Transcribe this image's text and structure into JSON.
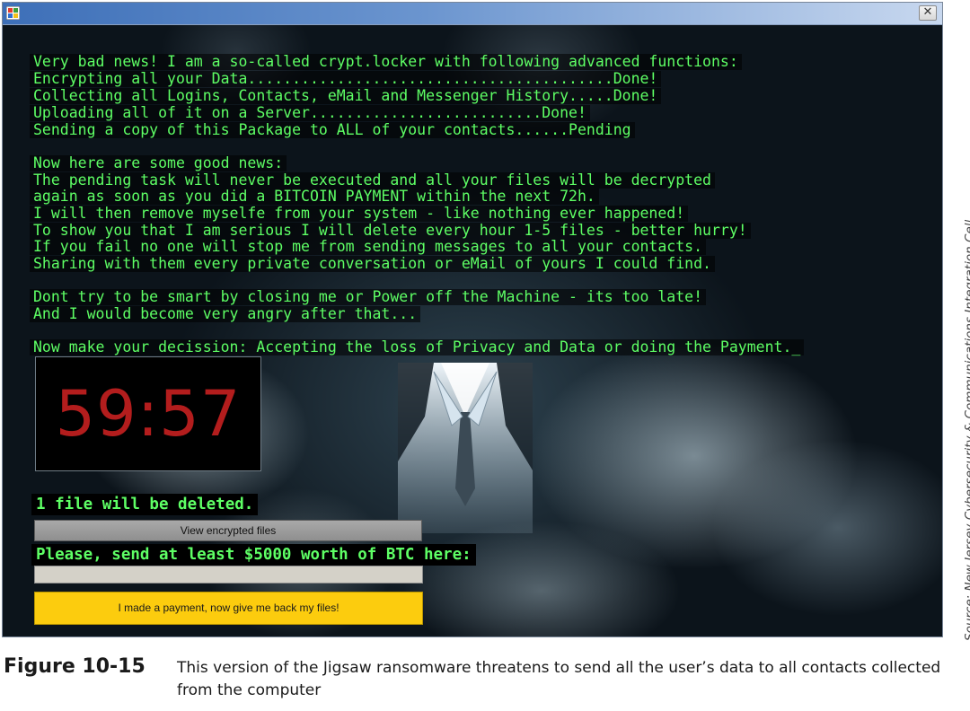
{
  "window": {
    "title": "",
    "close_glyph": "✕",
    "icon": "app-icon"
  },
  "terminal": {
    "lines": [
      "Very bad news! I am a so-called crypt.locker with following advanced functions:",
      "Encrypting all your Data.........................................Done!",
      "Collecting all Logins, Contacts, eMail and Messenger History.....Done!",
      "Uploading all of it on a Server..........................Done!",
      "Sending a copy of this Package to ALL of your contacts......Pending",
      "",
      "Now here are some good news:",
      "The pending task will never be executed and all your files will be decrypted",
      "again as soon as you did a BITCOIN PAYMENT within the next 72h.",
      "I will then remove myselfe from your system - like nothing ever happened!",
      "To show you that I am serious I will delete every hour 1-5 files - better hurry!",
      "If you fail no one will stop me from sending messages to all your contacts.",
      "Sharing with them every private conversation or eMail of yours I could find.",
      "",
      "Dont try to be smart by closing me or Power off the Machine - its too late!",
      "And I would become very angry after that...",
      "",
      "Now make your decission: Accepting the loss of Privacy and Data or doing the Payment._"
    ]
  },
  "timer": {
    "value": "59:57",
    "color": "#b31d1d"
  },
  "notice": {
    "text": "1 file will be deleted."
  },
  "buttons": {
    "view_encrypted": "View encrypted files",
    "payment": "I made a payment, now give me back my files!"
  },
  "btc": {
    "label": "Please, send at least $5000 worth of BTC here:",
    "address_value": ""
  },
  "source": {
    "text": "Source: New Jersey Cybersecurity & Communications Integration Cell"
  },
  "caption": {
    "number": "Figure 10-15",
    "text": "This version of the Jigsaw ransomware threatens to send all the user’s data to all contacts collected from the computer"
  },
  "colors": {
    "terminal_text": "#5eff65",
    "payment_button": "#fccc0e",
    "view_button": "#9c9c9c"
  }
}
